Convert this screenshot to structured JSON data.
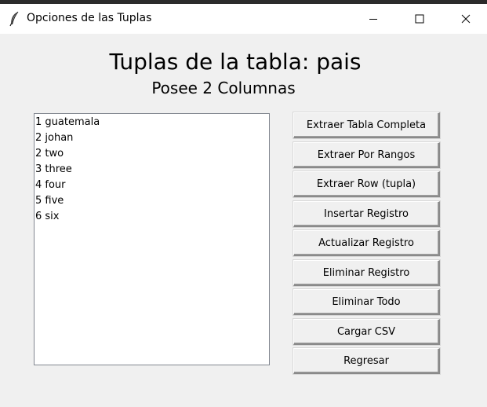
{
  "window": {
    "title": "Opciones de las Tuplas",
    "icon": "feather-icon"
  },
  "header": {
    "title": "Tuplas de la tabla: pais",
    "subtitle": "Posee 2 Columnas"
  },
  "list": {
    "items": [
      "1 guatemala",
      "2 johan",
      "2 two",
      "3 three",
      "4 four",
      "5 five",
      "6 six"
    ]
  },
  "buttons": [
    "Extraer Tabla Completa",
    "Extraer Por Rangos",
    "Extraer Row (tupla)",
    "Insertar Registro",
    "Actualizar Registro",
    "Eliminar Registro",
    "Eliminar Todo",
    "Cargar CSV",
    "Regresar"
  ]
}
